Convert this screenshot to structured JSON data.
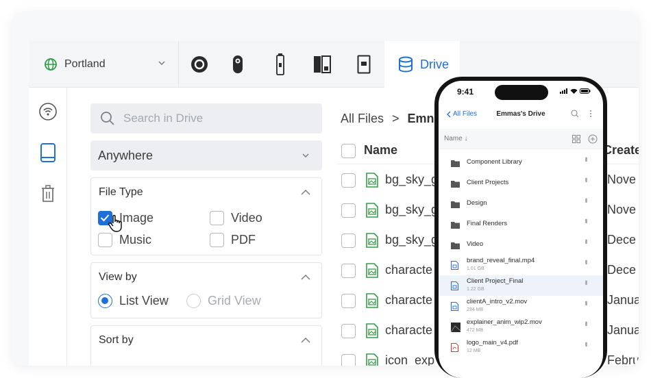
{
  "topbar": {
    "location": "Portland",
    "devices": [
      "camera-icon",
      "dashcam-icon",
      "stick-icon",
      "hub-icon",
      "doorbell-icon"
    ],
    "drive_tab": "Drive"
  },
  "rail": {
    "items": [
      "wifi-icon",
      "drive-icon",
      "trash-icon"
    ]
  },
  "filters": {
    "search_placeholder": "Search in Drive",
    "location_select": "Anywhere",
    "file_type": {
      "title": "File Type",
      "options": [
        {
          "label": "Image",
          "checked": true
        },
        {
          "label": "Video",
          "checked": false
        },
        {
          "label": "Music",
          "checked": false
        },
        {
          "label": "PDF",
          "checked": false
        }
      ]
    },
    "view_by": {
      "title": "View by",
      "options": [
        {
          "label": "List View",
          "selected": true
        },
        {
          "label": "Grid View",
          "selected": false
        }
      ]
    },
    "sort_by": {
      "title": "Sort by"
    }
  },
  "files": {
    "breadcrumb": [
      "All Files",
      ">",
      "Emn"
    ],
    "header": {
      "name": "Name",
      "created": "Create"
    },
    "rows": [
      {
        "name": "bg_sky_g",
        "date": "Nove"
      },
      {
        "name": "bg_sky_g",
        "date": "Nove"
      },
      {
        "name": "bg_sky_g",
        "date": "Dece"
      },
      {
        "name": "characte",
        "date": "Dece"
      },
      {
        "name": "characte",
        "date": "Janua"
      },
      {
        "name": "characte",
        "date": "Janua"
      },
      {
        "name": "icon_exp",
        "date": "Febru"
      }
    ]
  },
  "phone": {
    "time": "9:41",
    "back_label": "All Files",
    "title": "Emmas's Drive",
    "sort_label": "Name ↓",
    "items": [
      {
        "name": "Component Library",
        "size": "",
        "kind": "folder"
      },
      {
        "name": "Client Projects",
        "size": "",
        "kind": "folder"
      },
      {
        "name": "Design",
        "size": "",
        "kind": "folder"
      },
      {
        "name": "Final Renders",
        "size": "",
        "kind": "folder"
      },
      {
        "name": "Video",
        "size": "",
        "kind": "folder"
      },
      {
        "name": "brand_reveal_final.mp4",
        "size": "1.01 GB",
        "kind": "video"
      },
      {
        "name": "Client Project_Final",
        "size": "1.22 GB",
        "kind": "video"
      },
      {
        "name": "clientA_intro_v2.mov",
        "size": "234 MB",
        "kind": "video"
      },
      {
        "name": "explainer_anim_wip2.mov",
        "size": "472 MB",
        "kind": "thumb"
      },
      {
        "name": "logo_main_v4.pdf",
        "size": "12 MB",
        "kind": "pdf"
      }
    ]
  },
  "colors": {
    "accent": "#1e6fd8",
    "image_icon": "#3a9a4a"
  }
}
